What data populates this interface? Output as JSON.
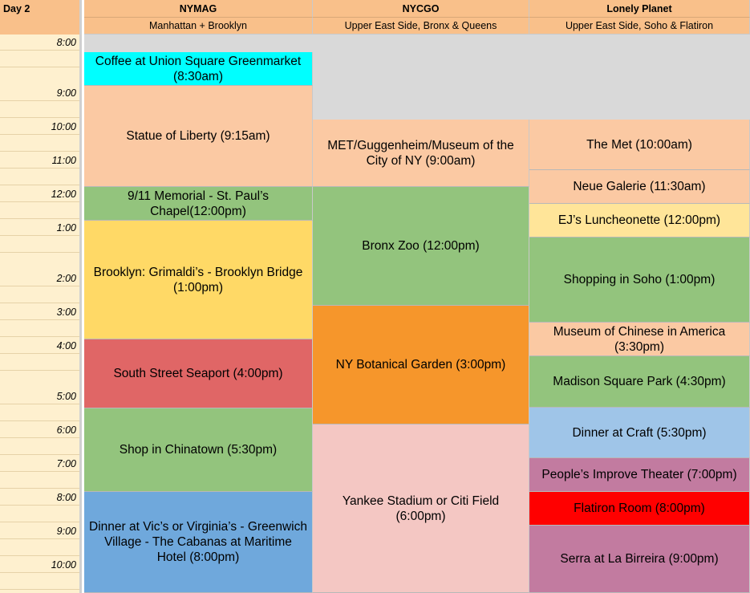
{
  "day_label": "Day 2",
  "times": [
    "8:00",
    "9:00",
    "10:00",
    "11:00",
    "12:00",
    "1:00",
    "2:00",
    "3:00",
    "4:00",
    "5:00",
    "6:00",
    "7:00",
    "8:00",
    "9:00",
    "10:00"
  ],
  "columns": [
    {
      "source": "NYMAG",
      "area": "Manhattan + Brooklyn",
      "events": [
        {
          "label": "Coffee at Union Square Greenmarket (8:30am)",
          "color": "#00ffff"
        },
        {
          "label": "Statue of Liberty (9:15am)",
          "color": "#fbc9a3"
        },
        {
          "label": "9/11 Memorial - St. Paul’s Chapel(12:00pm)",
          "color": "#93c47d"
        },
        {
          "label": "Brooklyn: Grimaldi’s - Brooklyn Bridge (1:00pm)",
          "color": "#ffd966"
        },
        {
          "label": "South Street Seaport (4:00pm)",
          "color": "#e06666"
        },
        {
          "label": "Shop in Chinatown (5:30pm)",
          "color": "#93c47d"
        },
        {
          "label": "Dinner at Vic’s or Virginia’s - Greenwich Village - The Cabanas at Maritime Hotel (8:00pm)",
          "color": "#6fa8dc"
        }
      ]
    },
    {
      "source": "NYCGO",
      "area": "Upper East Side, Bronx & Queens",
      "events": [
        {
          "label": "MET/Guggenheim/Museum of the City of NY (9:00am)",
          "color": "#fbc9a3"
        },
        {
          "label": "Bronx Zoo (12:00pm)",
          "color": "#93c47d"
        },
        {
          "label": "NY Botanical Garden (3:00pm)",
          "color": "#f6962b"
        },
        {
          "label": "Yankee Stadium or Citi Field (6:00pm)",
          "color": "#f4c7c3"
        }
      ]
    },
    {
      "source": "Lonely Planet",
      "area": "Upper East Side, Soho & Flatiron",
      "events": [
        {
          "label": "The Met (10:00am)",
          "color": "#fbc9a3"
        },
        {
          "label": "Neue Galerie (11:30am)",
          "color": "#fbc9a3"
        },
        {
          "label": "EJ’s Luncheonette (12:00pm)",
          "color": "#ffe599"
        },
        {
          "label": "Shopping in Soho (1:00pm)",
          "color": "#93c47d"
        },
        {
          "label": "Museum of Chinese in America (3:30pm)",
          "color": "#fbc9a3"
        },
        {
          "label": "Madison Square Park (4:30pm)",
          "color": "#93c47d"
        },
        {
          "label": "Dinner at Craft (5:30pm)",
          "color": "#9fc5e8"
        },
        {
          "label": "People’s Improve Theater (7:00pm)",
          "color": "#c27ba0"
        },
        {
          "label": "Flatiron Room (8:00pm)",
          "color": "#ff0000"
        },
        {
          "label": "Serra at La Birreira (9:00pm)",
          "color": "#c27ba0"
        }
      ]
    }
  ]
}
